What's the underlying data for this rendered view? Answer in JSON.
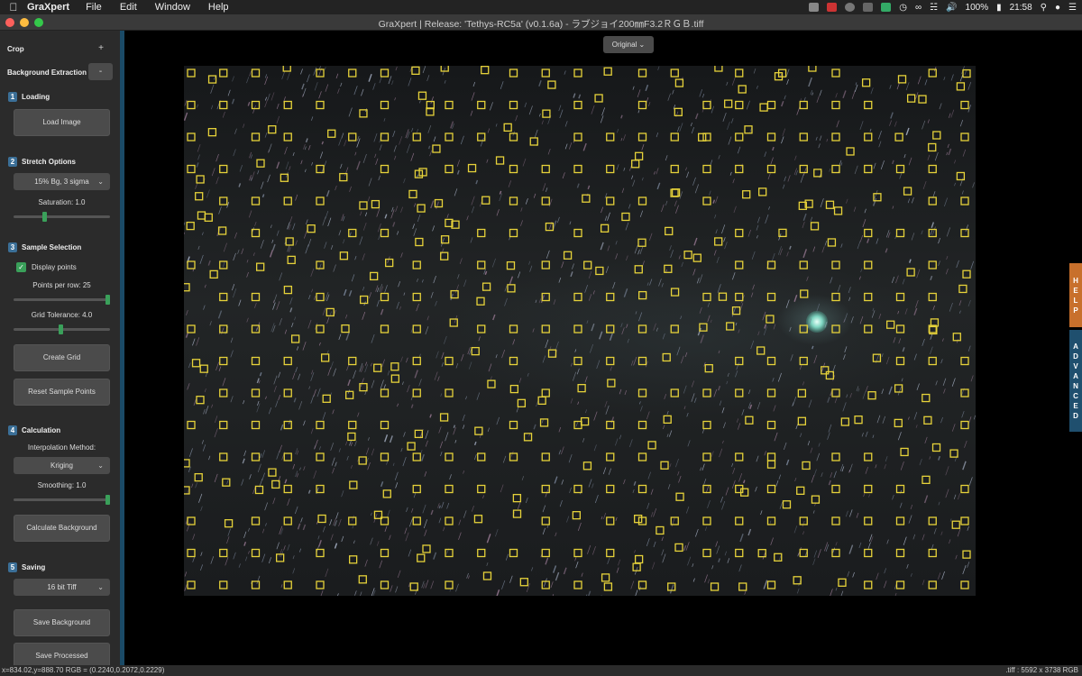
{
  "menubar": {
    "app_name": "GraXpert",
    "menus": [
      "File",
      "Edit",
      "Window",
      "Help"
    ],
    "battery": "100%",
    "clock": "21:58"
  },
  "window": {
    "title": "GraXpert | Release: 'Tethys-RC5a' (v0.1.6a) - ラブジョイ200㎜F3.2ＲＧＢ.tiff"
  },
  "sidebar": {
    "crop_label": "Crop",
    "crop_toggle": "+",
    "bg_extraction_label": "Background Extraction",
    "bg_extraction_toggle": "-",
    "loading": {
      "num": "1",
      "title": "Loading",
      "load_button": "Load Image"
    },
    "stretch": {
      "num": "2",
      "title": "Stretch Options",
      "selected": "15% Bg, 3 sigma",
      "saturation_label": "Saturation: 1.0",
      "saturation": 1.0
    },
    "sample": {
      "num": "3",
      "title": "Sample Selection",
      "display_points_label": "Display points",
      "points_per_row_label": "Points per row: 25",
      "grid_tolerance_label": "Grid Tolerance: 4.0",
      "create_grid": "Create Grid",
      "reset_points": "Reset Sample Points"
    },
    "calculation": {
      "num": "4",
      "title": "Calculation",
      "interp_label": "Interpolation Method:",
      "interp_selected": "Kriging",
      "smoothing_label": "Smoothing: 1.0",
      "calc_button": "Calculate Background"
    },
    "saving": {
      "num": "5",
      "title": "Saving",
      "format_selected": "16 bit Tiff",
      "save_background": "Save Background",
      "save_processed": "Save Processed"
    }
  },
  "main": {
    "view_selector": "Original"
  },
  "side_tabs": {
    "help": "HELP",
    "advanced": "ADVANCED"
  },
  "statusbar": {
    "left": "x=834.02,y=888.70  RGB = (0.2240,0.2072,0.2229)",
    "right": ".tiff : 5592 x 3738 RGB"
  },
  "colors": {
    "sample_point": "#e6d23a",
    "accent_green": "#3aa05a",
    "step_blue": "#3b6f97",
    "help_orange": "#c8702c",
    "advanced_blue": "#1f4f6e"
  }
}
